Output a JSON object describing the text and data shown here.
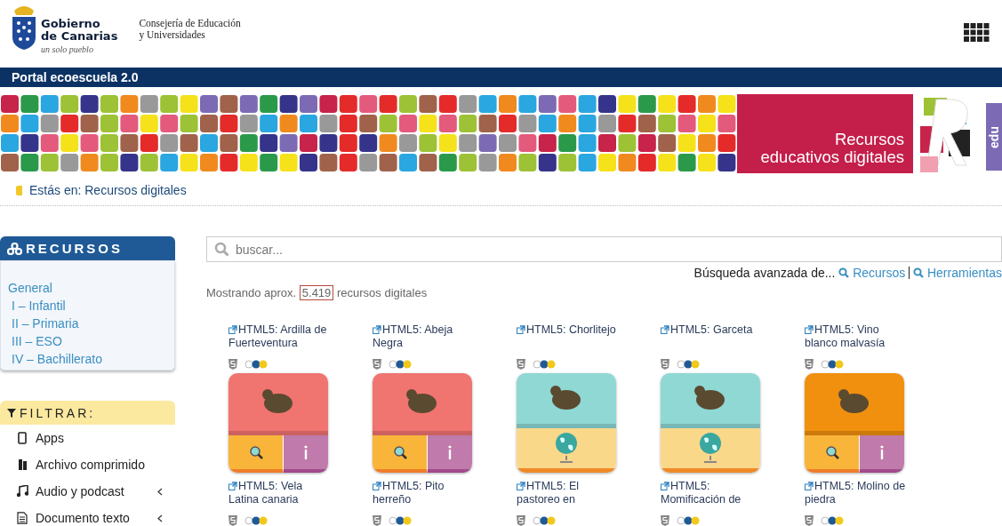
{
  "header": {
    "logo_title": [
      "Gobierno",
      "de Canarias"
    ],
    "slogan": "un solo pueblo",
    "department": [
      "Consejería de Educación",
      "y Universidades"
    ]
  },
  "portal_bar": {
    "title": "Portal ecoescuela 2.0"
  },
  "banner": {
    "title": [
      "Recursos",
      "educativos digitales"
    ],
    "logo_text": "edu"
  },
  "breadcrumb": "Estás en: Recursos digitales",
  "sidebar": {
    "resources": {
      "title": "RECURSOS",
      "items": [
        {
          "label": "General",
          "children": [
            {
              "label": "I – Infantil"
            },
            {
              "label": "II – Primaria"
            },
            {
              "label": "III – ESO"
            },
            {
              "label": "IV – Bachillerato"
            }
          ]
        }
      ]
    },
    "filter": {
      "title": "FILTRAR:",
      "items": [
        {
          "label": "Apps",
          "kind": "apps",
          "has_submenu": false
        },
        {
          "label": "Archivo comprimido",
          "kind": "archive",
          "has_submenu": false
        },
        {
          "label": "Audio y podcast",
          "kind": "audio",
          "has_submenu": true
        },
        {
          "label": "Documento texto",
          "kind": "document",
          "has_submenu": true
        }
      ]
    }
  },
  "search": {
    "placeholder": "buscar..."
  },
  "advanced_search": {
    "label": "Búsqueda avanzada de...",
    "links": [
      "Recursos",
      "Herramientas"
    ]
  },
  "results": {
    "prefix": "Mostrando aprox.",
    "count": "5.419",
    "suffix": "recursos digitales"
  },
  "cards": [
    {
      "title": "HTML5: Ardilla de Fuerteventura",
      "kind": "split",
      "color": "#f07470"
    },
    {
      "title": "HTML5: Abeja Negra",
      "kind": "split",
      "color": "#f07470"
    },
    {
      "title": "HTML5: Chorlitejo",
      "kind": "globe",
      "color": "#8fd8d4"
    },
    {
      "title": "HTML5: Garceta",
      "kind": "globe",
      "color": "#8fd8d4"
    },
    {
      "title": "HTML5: Vino blanco malvasía",
      "kind": "split",
      "color": "#f0900e"
    },
    {
      "title": "HTML5: Vela Latina canaria",
      "kind": "plain"
    },
    {
      "title": "HTML5: Pito herreño",
      "kind": "plain"
    },
    {
      "title": "HTML5: El pastoreo en",
      "kind": "plain"
    },
    {
      "title": "HTML5: Momificación de",
      "kind": "plain"
    },
    {
      "title": "HTML5: Molino de piedra",
      "kind": "plain"
    }
  ]
}
